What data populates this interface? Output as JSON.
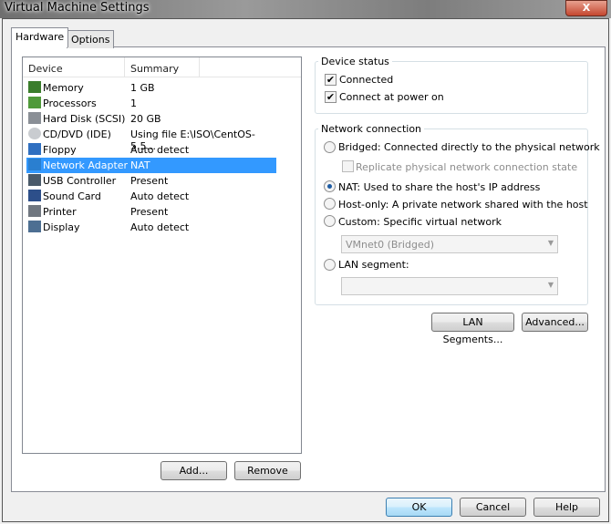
{
  "window": {
    "title": "Virtual Machine Settings",
    "close": "X"
  },
  "tabs": [
    {
      "label": "Hardware",
      "active": true
    },
    {
      "label": "Options",
      "active": false
    }
  ],
  "devices": {
    "columns": [
      "Device",
      "Summary"
    ],
    "rows": [
      {
        "device": "Memory",
        "summary": "1 GB",
        "icon": "memory-icon"
      },
      {
        "device": "Processors",
        "summary": "1",
        "icon": "processor-icon"
      },
      {
        "device": "Hard Disk (SCSI)",
        "summary": "20 GB",
        "icon": "hard-disk-icon"
      },
      {
        "device": "CD/DVD (IDE)",
        "summary": "Using file E:\\ISO\\CentOS-5.5...",
        "icon": "cd-dvd-icon"
      },
      {
        "device": "Floppy",
        "summary": "Auto detect",
        "icon": "floppy-icon"
      },
      {
        "device": "Network Adapter",
        "summary": "NAT",
        "icon": "network-adapter-icon",
        "selected": true
      },
      {
        "device": "USB Controller",
        "summary": "Present",
        "icon": "usb-icon"
      },
      {
        "device": "Sound Card",
        "summary": "Auto detect",
        "icon": "sound-card-icon"
      },
      {
        "device": "Printer",
        "summary": "Present",
        "icon": "printer-icon"
      },
      {
        "device": "Display",
        "summary": "Auto detect",
        "icon": "display-icon"
      }
    ],
    "add": "Add...",
    "remove": "Remove"
  },
  "device_status": {
    "title": "Device status",
    "connected": {
      "label": "Connected",
      "checked": true
    },
    "connect_power_on": {
      "label": "Connect at power on",
      "checked": true
    }
  },
  "network": {
    "title": "Network connection",
    "bridged": "Bridged: Connected directly to the physical network",
    "replicate": "Replicate physical network connection state",
    "nat": "NAT: Used to share the host's IP address",
    "hostonly": "Host-only: A private network shared with the host",
    "custom": "Custom: Specific virtual network",
    "custom_value": "VMnet0 (Bridged)",
    "lan": "LAN segment:",
    "lan_value": "",
    "selected": "nat",
    "lan_segments_btn": "LAN Segments...",
    "advanced_btn": "Advanced..."
  },
  "footer": {
    "ok": "OK",
    "cancel": "Cancel",
    "help": "Help"
  }
}
